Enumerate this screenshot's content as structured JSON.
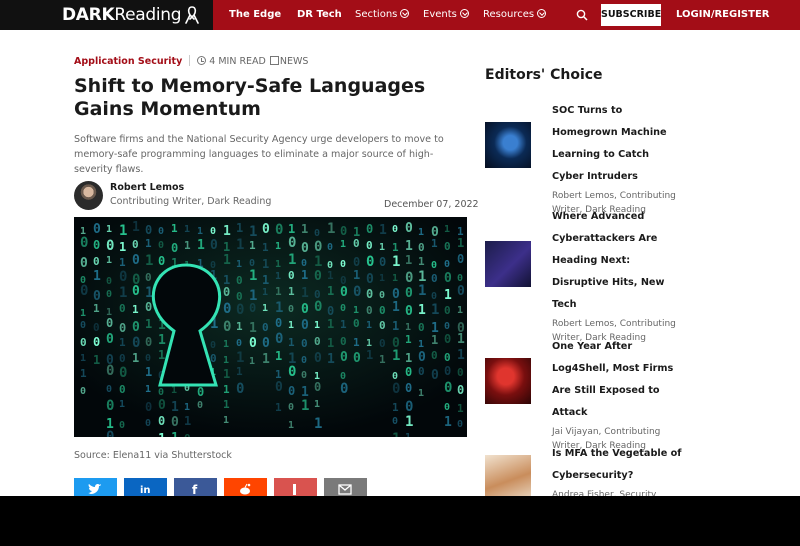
{
  "nav": {
    "logo_bold": "DARK",
    "logo_light": "Reading",
    "items": [
      {
        "label": "The Edge"
      },
      {
        "label": "DR Tech"
      },
      {
        "label": "Sections"
      },
      {
        "label": "Events"
      },
      {
        "label": "Resources"
      }
    ],
    "subscribe": "SUBSCRIBE",
    "login": "LOGIN/REGISTER"
  },
  "article": {
    "category": "Application Security",
    "read_time": "4 MIN READ",
    "type": "NEWS",
    "headline": "Shift to Memory-Safe Languages Gains Momentum",
    "dek": "Software firms and the National Security Agency urge developers to move to memory-safe programming languages to eliminate a major source of high-severity flaws.",
    "author": {
      "name": "Robert Lemos",
      "role": "Contributing Writer, Dark Reading"
    },
    "date": "December 07, 2022",
    "image_source": "Source: Elena11 via Shutterstock"
  },
  "share": [
    {
      "icon": "twitter-icon",
      "color": "#1d9bf0"
    },
    {
      "icon": "linkedin-icon",
      "color": "#0a66c2"
    },
    {
      "icon": "facebook-icon",
      "color": "#3b5998"
    },
    {
      "icon": "reddit-icon",
      "color": "#ff4500"
    },
    {
      "icon": "like-icon",
      "color": "#d9534f"
    },
    {
      "icon": "email-icon",
      "color": "#7a7a7a"
    }
  ],
  "editors_choice": {
    "title": "Editors' Choice",
    "items": [
      {
        "headline": "SOC Turns to Homegrown Machine Learning to Catch Cyber Intruders",
        "author": "Robert Lemos, Contributing Writer, Dark Reading"
      },
      {
        "headline": "Where Advanced Cyberattackers Are Heading Next: Disruptive Hits, New Tech",
        "author": "Robert Lemos, Contributing Writer, Dark Reading"
      },
      {
        "headline": "One Year After Log4Shell, Most Firms Are Still Exposed to Attack",
        "author": "Jai Vijayan, Contributing Writer, Dark Reading"
      },
      {
        "headline": "Is MFA the Vegetable of Cybersecurity?",
        "author": "Andrea Fisher, Security"
      }
    ]
  },
  "colors": {
    "brand": "#a30d17",
    "logo_bg": "#111111"
  }
}
